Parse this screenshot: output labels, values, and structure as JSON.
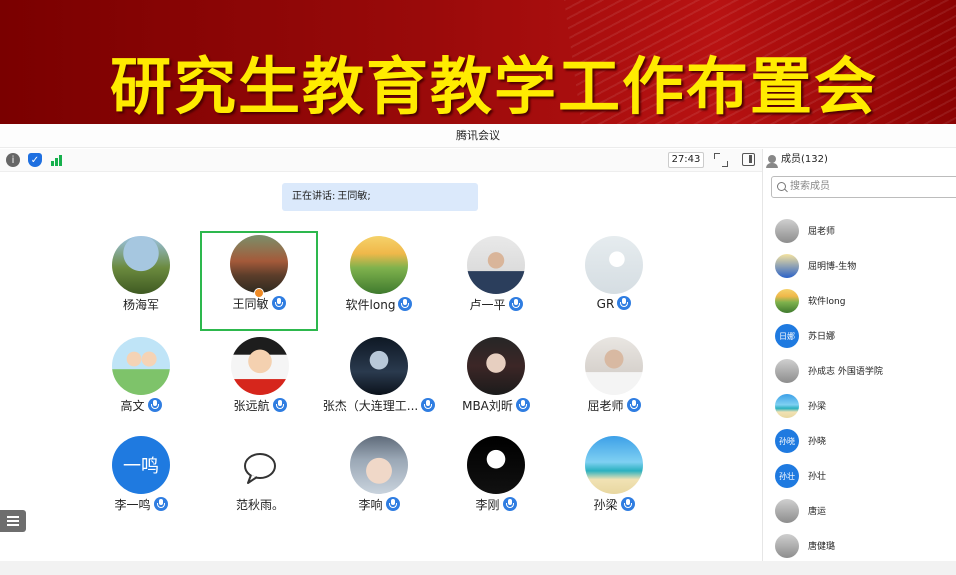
{
  "banner": {
    "title": "研究生教育教学工作布置会"
  },
  "window": {
    "title": "腾讯会议"
  },
  "toolbar": {
    "timer": "27:43"
  },
  "speaking": {
    "prefix": "正在讲话:",
    "name": "王同敏;"
  },
  "participants": [
    {
      "name": "杨海军",
      "mic": false,
      "avatar": "photo-hiker"
    },
    {
      "name": "王同敏",
      "mic": true,
      "avatar": "photo-landscape",
      "active": true
    },
    {
      "name": "软件long",
      "mic": true,
      "avatar": "photo-hills"
    },
    {
      "name": "卢一平",
      "mic": true,
      "avatar": "photo-man"
    },
    {
      "name": "GR",
      "mic": true,
      "avatar": "photo-flower"
    },
    {
      "name": "高文",
      "mic": true,
      "avatar": "cartoon-kids"
    },
    {
      "name": "张远航",
      "mic": true,
      "avatar": "cartoon-face"
    },
    {
      "name": "张杰（大连理工...",
      "mic": true,
      "avatar": "game-character"
    },
    {
      "name": "MBA刘昕",
      "mic": true,
      "avatar": "photo-portrait"
    },
    {
      "name": "屈老师",
      "mic": true,
      "avatar": "photo-man-statue"
    },
    {
      "name": "李一鸣",
      "mic": true,
      "avatar": "text-avatar",
      "avatar_text": "一鸣"
    },
    {
      "name": "范秋雨。",
      "mic": false,
      "avatar": "speech-bubble-icon"
    },
    {
      "name": "李响",
      "mic": true,
      "avatar": "photo-baby"
    },
    {
      "name": "李刚",
      "mic": true,
      "avatar": "astronaut"
    },
    {
      "name": "孙梁",
      "mic": true,
      "avatar": "photo-beach"
    }
  ],
  "sidebar": {
    "members_title": "成员(132)",
    "search_placeholder": "搜索成员",
    "members": [
      {
        "name": "屈老师",
        "avatar": "photo"
      },
      {
        "name": "屈明博-生物",
        "avatar": "cartoon"
      },
      {
        "name": "软件long",
        "avatar": "photo-hills"
      },
      {
        "name": "苏日娜",
        "avatar": "text",
        "text": "日娜"
      },
      {
        "name": "孙成志 外国语学院",
        "avatar": "photo"
      },
      {
        "name": "孙梁",
        "avatar": "photo-beach"
      },
      {
        "name": "孙晓",
        "avatar": "text",
        "text": "孙晓"
      },
      {
        "name": "孙壮",
        "avatar": "text",
        "text": "孙壮"
      },
      {
        "name": "唐运",
        "avatar": "photo"
      },
      {
        "name": "唐健璐",
        "avatar": "photo"
      }
    ]
  },
  "colors": {
    "accent": "#2f7de1",
    "active_border": "#2db84d",
    "banner_text": "#ffeb00"
  }
}
